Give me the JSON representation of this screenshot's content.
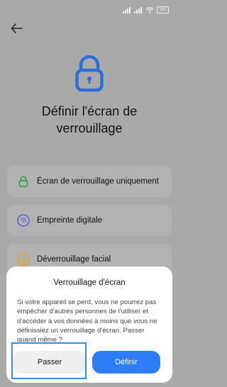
{
  "status_bar": {
    "battery": "100"
  },
  "page": {
    "title": "Définir l'écran de verrouillage"
  },
  "options": [
    {
      "label": "Écran de verrouillage uniquement",
      "icon": "lock-icon",
      "color": "#2e9e4a"
    },
    {
      "label": "Empreinte digitale",
      "icon": "fingerprint-icon",
      "color": "#5b5fd6"
    },
    {
      "label": "Déverrouillage facial",
      "icon": "face-icon",
      "color": "#e6a21c"
    }
  ],
  "dialog": {
    "title": "Verrouillage d'écran",
    "message": "Si votre appareil se perd, vous ne pourrez pas empêcher d'autres personnes de l'utiliser et d'accéder à vos données à moins que vous ne définissiez un verrouillage d'écran. Passer quand même ?",
    "skip_label": "Passer",
    "define_label": "Définir"
  },
  "colors": {
    "accent": "#2d7ef6",
    "highlight": "#2a93ea",
    "overlay": "#a9a9a9"
  }
}
